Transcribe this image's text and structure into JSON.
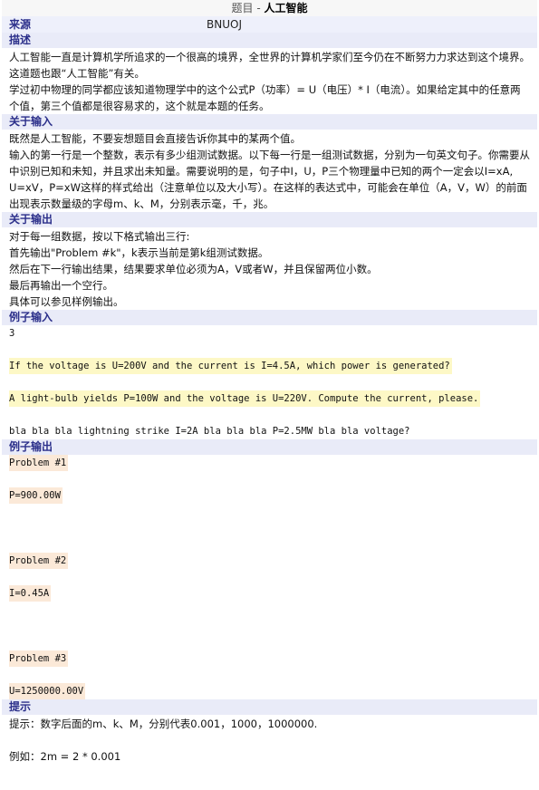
{
  "header": {
    "prefix": "题目 - ",
    "title": "人工智能"
  },
  "source": {
    "label": "来源",
    "value": "BNUOJ"
  },
  "description": {
    "label": "描述",
    "lines": [
      "人工智能一直是计算机学所追求的一个很高的境界，全世界的计算机学家们至今仍在不断努力力求达到这个境界。",
      "这道题也跟“人工智能”有关。",
      "学过初中物理的同学都应该知道物理学中的这个公式P（功率）= U（电压）* I（电流）。如果给定其中的任意两个值，第三个值都是很容易求的，这个就是本题的任务。"
    ]
  },
  "input": {
    "label": "关于输入",
    "lines": [
      "既然是人工智能，不要妄想题目会直接告诉你其中的某两个值。",
      "输入的第一行是一个整数，表示有多少组测试数据。以下每一行是一组测试数据，分别为一句英文句子。你需要从中识别已知和未知，并且求出未知量。需要说明的是，句子中I，U，P三个物理量中已知的两个一定会以I=xA, U=xV，P=xW这样的样式给出（注意单位以及大小写）。在这样的表达式中，可能会在单位（A，V，W）的前面出现表示数量级的字母m、k、M，分别表示毫，千，兆。"
    ]
  },
  "output": {
    "label": "关于输出",
    "lines": [
      "对于每一组数据，按以下格式输出三行:",
      "首先输出\"Problem #k\"，k表示当前是第k组测试数据。",
      "然后在下一行输出结果，结果要求单位必须为A，V或者W，并且保留两位小数。",
      "最后再输出一个空行。",
      "具体可以参见样例输出。"
    ]
  },
  "sample_input": {
    "label": "例子输入",
    "count": "3",
    "lines": [
      "If the voltage is U=200V and the current is I=4.5A, which power is generated?",
      "A light-bulb yields P=100W and the voltage is U=220V. Compute the current, please.",
      "bla bla bla lightning strike I=2A bla bla bla P=2.5MW bla bla voltage?"
    ]
  },
  "sample_output": {
    "label": "例子输出",
    "items": [
      {
        "problem": "Problem #1",
        "result": "P=900.00W"
      },
      {
        "problem": "Problem #2",
        "result": "I=0.45A"
      },
      {
        "problem": "Problem #3",
        "result": "U=1250000.00V"
      }
    ]
  },
  "hint": {
    "label": "提示",
    "line1": "提示：数字后面的m、k、M，分别代表0.001，1000，1000000.",
    "line2": "例如：2m = 2 * 0.001"
  },
  "colors": {
    "section_bg": "#e9ebf8",
    "section_text": "#2b2f8a",
    "input_highlight": "#fdf8c6",
    "output_highlight": "#fbe9d8"
  }
}
